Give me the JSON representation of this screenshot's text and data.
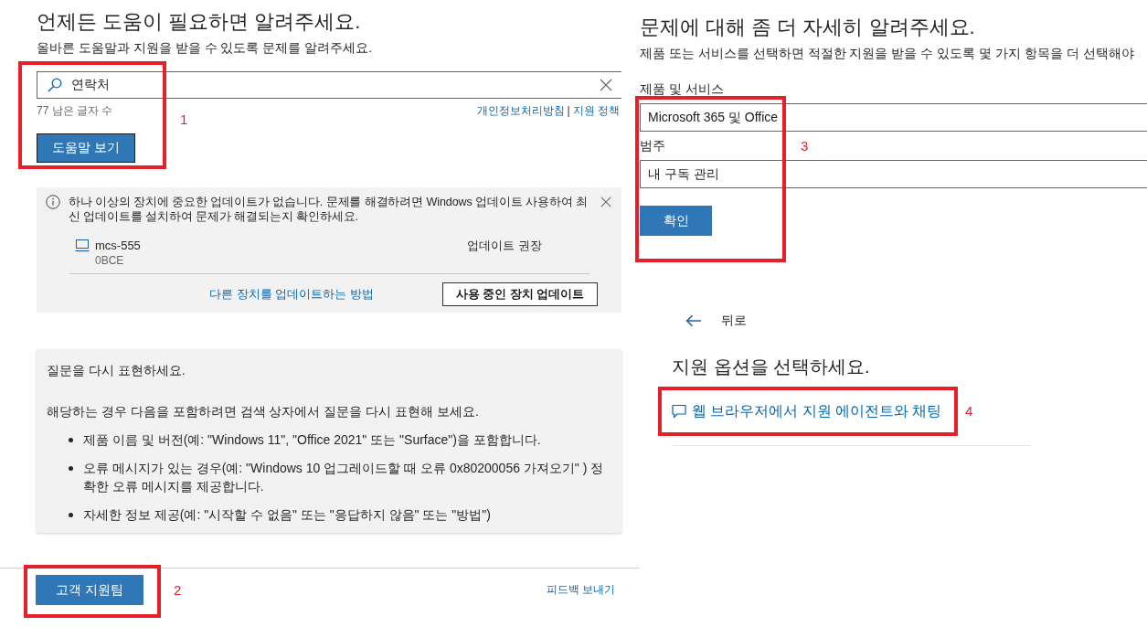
{
  "left_panel": {
    "title": "언제든 도움이 필요하면 알려주세요.",
    "subtitle": "올바른 도움말과 지원을 받을 수 있도록 문제를 알려주세요.",
    "search": {
      "value": "연락처",
      "remaining": "77 남은 글자 수",
      "policy_links": [
        "개인정보처리방침",
        "지원 정책"
      ],
      "separator": "|",
      "button": "도움말 보기",
      "annotation": "1"
    },
    "update_notice": {
      "message": "하나 이상의 장치에 중요한 업데이트가 없습니다. 문제를 해결하려면 Windows 업데이트 사용하여 최신 업데이트를 설치하여 문제가 해결되는지 확인하세요.",
      "device": {
        "name": "mcs-555",
        "id": "0BCE",
        "status": "업데이트 권장"
      },
      "link": "다른 장치를 업데이트하는 방법",
      "button": "사용 중인 장치 업데이트"
    },
    "rephrase_tips": {
      "title": "질문을 다시 표현하세요.",
      "intro": "해당하는 경우 다음을 포함하려면 검색 상자에서 질문을 다시 표현해 보세요.",
      "bullets": [
        "제품 이름 및 버전(예: \"Windows 11\", \"Office 2021\" 또는 \"Surface\")을 포함합니다.",
        "오류 메시지가 있는 경우(예: \"Windows 10 업그레이드할 때 오류 0x80200056 가져오기\" ) 정확한 오류 메시지를 제공합니다.",
        "자세한 정보 제공(예: \"시작할 수 없음\" 또는 \"응답하지 않음\" 또는 \"방법\")"
      ]
    },
    "footer": {
      "button": "고객 지원팀",
      "annotation": "2",
      "feedback_link": "피드백 보내기"
    }
  },
  "right_panel": {
    "title": "문제에 대해 좀 더 자세히 알려주세요.",
    "subtitle": "제품 또는 서비스를 선택하면 적절한 지원을 받을 수 있도록 몇 가지 항목을 더 선택해야",
    "form": {
      "fields": [
        {
          "label": "제품 및 서비스",
          "value": "Microsoft 365 및 Office"
        },
        {
          "label": "범주",
          "value": "내 구독 관리"
        }
      ],
      "button": "확인",
      "annotation": "3"
    },
    "support_options": {
      "back": "뒤로",
      "title": "지원 옵션을 선택하세요.",
      "options": [
        {
          "label": "웹 브라우저에서 지원 에이전트와 채팅",
          "annotation": "4"
        }
      ]
    }
  }
}
